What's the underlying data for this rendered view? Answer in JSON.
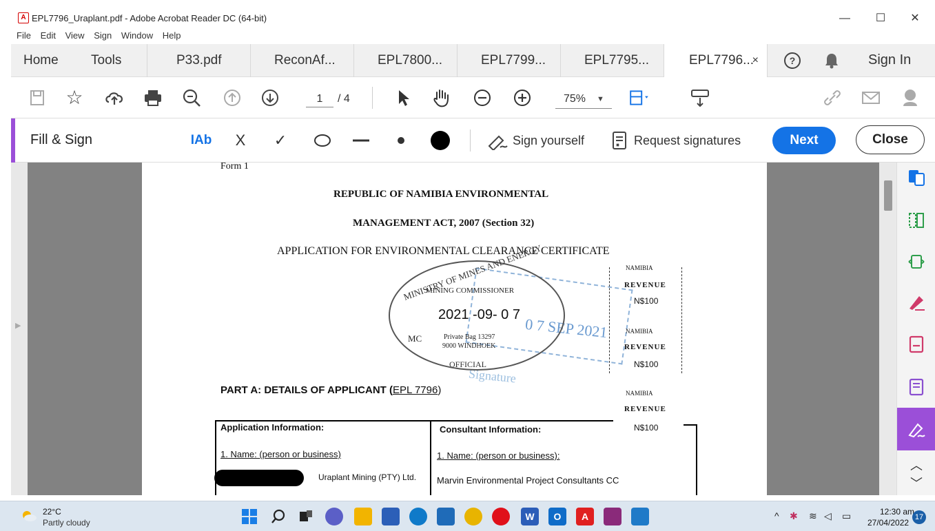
{
  "window": {
    "title": "EPL7796_Uraplant.pdf - Adobe Acrobat Reader DC (64-bit)",
    "minimize": "—",
    "maximize": "☐",
    "close": "✕"
  },
  "menu": [
    "File",
    "Edit",
    "View",
    "Sign",
    "Window",
    "Help"
  ],
  "tabs": {
    "home": "Home",
    "tools": "Tools",
    "docs": [
      "P33.pdf",
      "ReconAf...",
      "EPL7800...",
      "EPL7799...",
      "EPL7795...",
      "EPL7796..."
    ],
    "close_glyph": "×",
    "help": "?",
    "sign_in": "Sign In"
  },
  "toolbar": {
    "page_current": "1",
    "page_total": "/ 4",
    "zoom": "75%"
  },
  "fill_sign": {
    "label": "Fill & Sign",
    "text_tool": "IAb",
    "cross": "X",
    "check": "✓",
    "sign_yourself": "Sign yourself",
    "request_signatures": "Request signatures",
    "next": "Next",
    "close": "Close"
  },
  "document": {
    "form_label": "Form 1",
    "heading1": "REPUBLIC OF NAMIBIA ENVIRONMENTAL",
    "heading2": "MANAGEMENT ACT, 2007 (Section 32)",
    "heading3": "APPLICATION FOR ENVIRONMENTAL CLEARANCE CERTIFICATE",
    "stamp": {
      "ring": "MINISTRY OF MINES AND ENERGY",
      "commissioner": "MINING COMMISSIONER",
      "date": "2021 -09- 0 7",
      "mc": "MC",
      "bag": "Private Bag 13297",
      "city": "9000 WINDHOEK",
      "official": "OFFICIAL",
      "blue_date": "0 7 SEP 2021",
      "blue_sig": "Signature"
    },
    "revenue": [
      {
        "country": "NAMIBIA",
        "word": "REVENUE",
        "amount": "N$100"
      },
      {
        "country": "NAMIBIA",
        "word": "REVENUE",
        "amount": "N$100"
      },
      {
        "country": "NAMIBIA",
        "word": "REVENUE",
        "amount": "N$100"
      }
    ],
    "part_a": "PART A: DETAILS OF APPLICANT (",
    "part_a_link": "EPL 7796",
    "part_a_end": ")",
    "app_info": "Application Information:",
    "cons_info": "Consultant Information:",
    "app_name_label": "1. Name: (person or business)",
    "cons_name_label": "1. Name: (person or business):",
    "app_name_value": "Uraplant Mining (PTY) Ltd.",
    "cons_name_value": "Marvin Environmental Project Consultants CC"
  },
  "taskbar": {
    "temp": "22°C",
    "weather": "Partly cloudy",
    "time": "12:30 am",
    "date": "27/04/2022",
    "notifications": "17"
  },
  "colors": {
    "accent_purple": "#9b4fd8",
    "next_blue": "#1473e6",
    "acrobat_red": "#d40000"
  }
}
